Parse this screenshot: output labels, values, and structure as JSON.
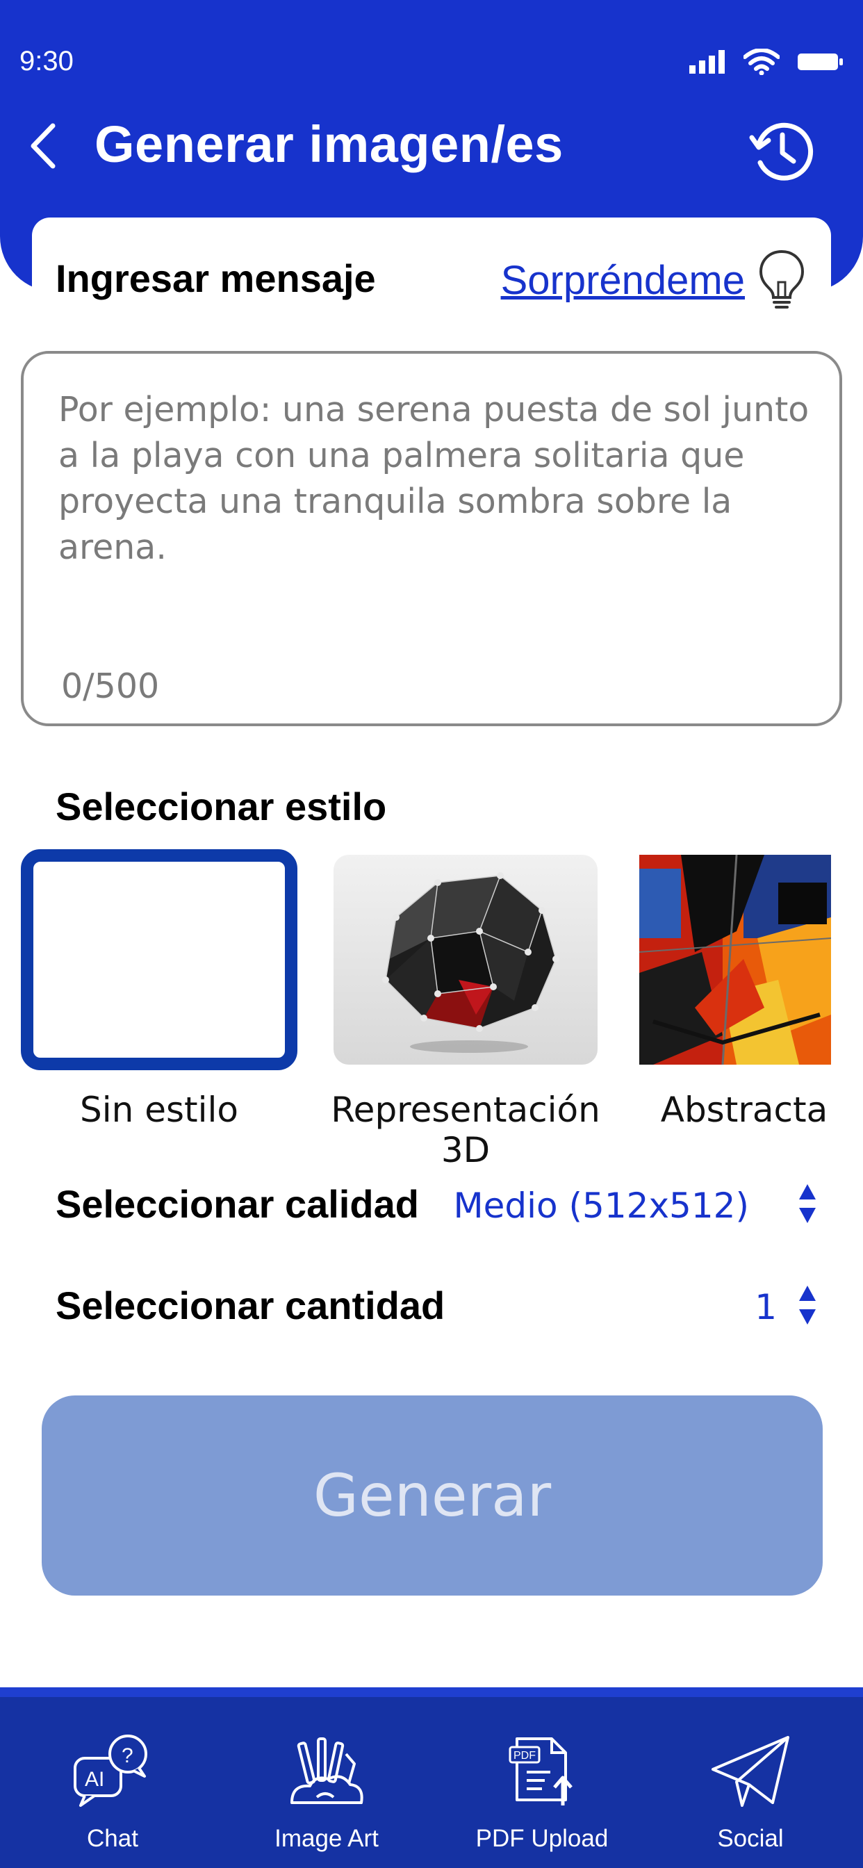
{
  "status_bar": {
    "time": "9:30",
    "icons": [
      "signal-icon",
      "wifi-icon",
      "battery-icon"
    ]
  },
  "header": {
    "title": "Generar imagen/es",
    "back_icon": "back-chevron-icon",
    "history_icon": "history-icon"
  },
  "message": {
    "label": "Ingresar mensaje",
    "surprise_link": "Sorpréndeme",
    "bulb_icon": "lightbulb-icon",
    "placeholder": "Por ejemplo: una serena puesta de sol junto a la playa con una palmera solitaria que proyecta una tranquila sombra sobre la arena.",
    "value": "",
    "counter": "0/500"
  },
  "style": {
    "label": "Seleccionar estilo",
    "options": [
      {
        "label": "Sin estilo",
        "selected": true
      },
      {
        "label": "Representación 3D",
        "selected": false
      },
      {
        "label": "Abstracta",
        "selected": false
      }
    ]
  },
  "quality": {
    "label": "Seleccionar calidad",
    "value": "Medio (512x512)"
  },
  "quantity": {
    "label": "Seleccionar cantidad",
    "value": "1"
  },
  "generate_button": {
    "label": "Generar",
    "disabled": true
  },
  "bottom_nav": {
    "items": [
      {
        "label": "Chat",
        "icon": "ai-chat-icon"
      },
      {
        "label": "Image Art",
        "icon": "art-tools-icon"
      },
      {
        "label": "PDF Upload",
        "icon": "pdf-upload-icon"
      },
      {
        "label": "Social",
        "icon": "paper-plane-icon"
      }
    ]
  },
  "colors": {
    "primary": "#1733cc",
    "nav_background": "#1532a3",
    "selected_border": "#0d3aa9",
    "button_disabled": "#7e9bd4"
  }
}
